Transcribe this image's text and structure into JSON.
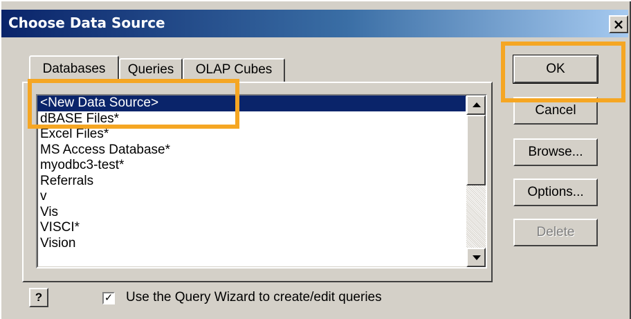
{
  "window": {
    "title": "Choose Data Source",
    "close_glyph": "×"
  },
  "tabs": [
    {
      "label": "Databases",
      "active": true
    },
    {
      "label": "Queries",
      "active": false
    },
    {
      "label": "OLAP Cubes",
      "active": false
    }
  ],
  "data_sources": [
    "<New Data Source>",
    "dBASE Files*",
    "Excel Files*",
    "MS Access Database*",
    "myodbc3-test*",
    "Referrals",
    "v",
    "Vis",
    "VISCI*",
    "Vision"
  ],
  "selected_source": "<New Data Source>",
  "buttons": {
    "ok": "OK",
    "cancel": "Cancel",
    "browse": "Browse...",
    "options": "Options...",
    "delete": "Delete"
  },
  "help_glyph": "?",
  "query_wizard": {
    "checked": true,
    "check_glyph": "✓",
    "label": "Use the Query Wizard to create/edit queries"
  },
  "colors": {
    "highlight": "#f5a623",
    "selection": "#0a246a",
    "face": "#d4d0c8"
  },
  "icons": [
    "close-icon",
    "scroll-up-icon",
    "scroll-down-icon",
    "help-icon",
    "checkmark-icon"
  ]
}
